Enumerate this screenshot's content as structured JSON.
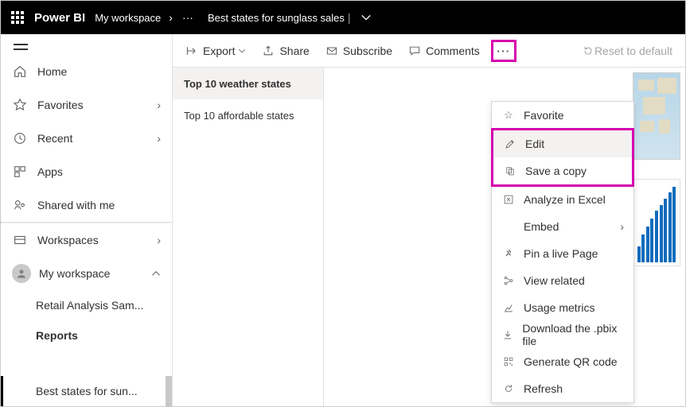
{
  "header": {
    "brand": "Power BI",
    "breadcrumb_workspace": "My workspace",
    "breadcrumb_ellipsis": "···",
    "report_title": "Best states for sunglass sales",
    "title_separator": "|"
  },
  "nav": {
    "home": "Home",
    "favorites": "Favorites",
    "recent": "Recent",
    "apps": "Apps",
    "shared": "Shared with me",
    "workspaces": "Workspaces",
    "my_workspace": "My workspace",
    "sub_retail": "Retail Analysis Sam...",
    "sub_reports": "Reports",
    "sub_current": "Best states for sun..."
  },
  "toolbar": {
    "export": "Export",
    "share": "Share",
    "subscribe": "Subscribe",
    "comments": "Comments",
    "reset": "Reset to default",
    "more": "···"
  },
  "pages": {
    "p0": "Top 10 weather states",
    "p1": "Top 10 affordable states"
  },
  "menu": {
    "favorite": "Favorite",
    "edit": "Edit",
    "save_copy": "Save a copy",
    "analyze_excel": "Analyze in Excel",
    "embed": "Embed",
    "pin": "Pin a live Page",
    "view_related": "View related",
    "usage": "Usage metrics",
    "download": "Download the .pbix file",
    "qr": "Generate QR code",
    "refresh": "Refresh"
  }
}
